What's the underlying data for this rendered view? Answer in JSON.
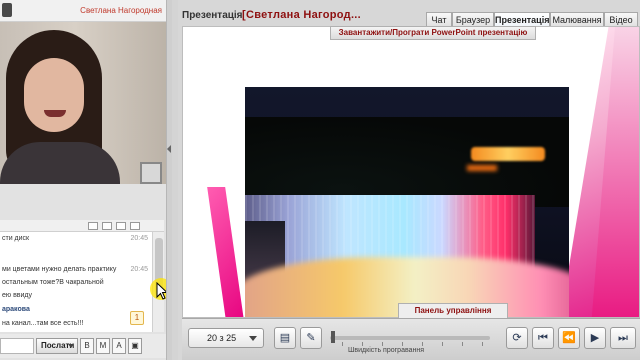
{
  "video": {
    "participant_name": "Светлана Нагородная",
    "icon": "person-icon",
    "popout_icon": "popout-icon"
  },
  "chat": {
    "toolbar_icons": [
      "settings-icon",
      "font-icon",
      "clear-icon",
      "save-icon"
    ],
    "messages": [
      {
        "text": "сти диск",
        "time": "20:45"
      },
      {
        "text": "ми цветами нужно делать практику",
        "time": "20:45"
      },
      {
        "text": " остальным тоже?В чакральной",
        "time": ""
      },
      {
        "text": "ею ввиду",
        "time": ""
      },
      {
        "author": "араковa",
        "text": "",
        "time": ""
      },
      {
        "text": " на канал...там все есть!!!",
        "time": ""
      }
    ],
    "unread_count": "1",
    "input_value": "",
    "send_label": "Послати",
    "controls": [
      "B",
      "M",
      "A",
      "▣"
    ]
  },
  "presentation": {
    "section_label": "Презентація",
    "title": "[Светлана Нагород...",
    "tabs": [
      {
        "label": "Чат",
        "active": false
      },
      {
        "label": "Браузер",
        "active": false
      },
      {
        "label": "Презентація",
        "active": true
      },
      {
        "label": "Малювання",
        "active": false
      },
      {
        "label": "Відео",
        "active": false
      }
    ],
    "upload_label": "Завантажити/Програти PowerPoint презентацію",
    "panel_label": "Панель управління",
    "page_indicator": "20 з 25",
    "speed_label": "Швидкість програвання",
    "speed_value_fraction": 0.0,
    "buttons": [
      "notes-icon",
      "pencil-icon",
      "refresh-icon",
      "first-slide-icon",
      "rewind-icon",
      "play-icon",
      "next-icon"
    ]
  },
  "colors": {
    "accent_red": "#8e1010",
    "slide_pink": "#e0007a",
    "cursor_halo": "#ffe600"
  }
}
